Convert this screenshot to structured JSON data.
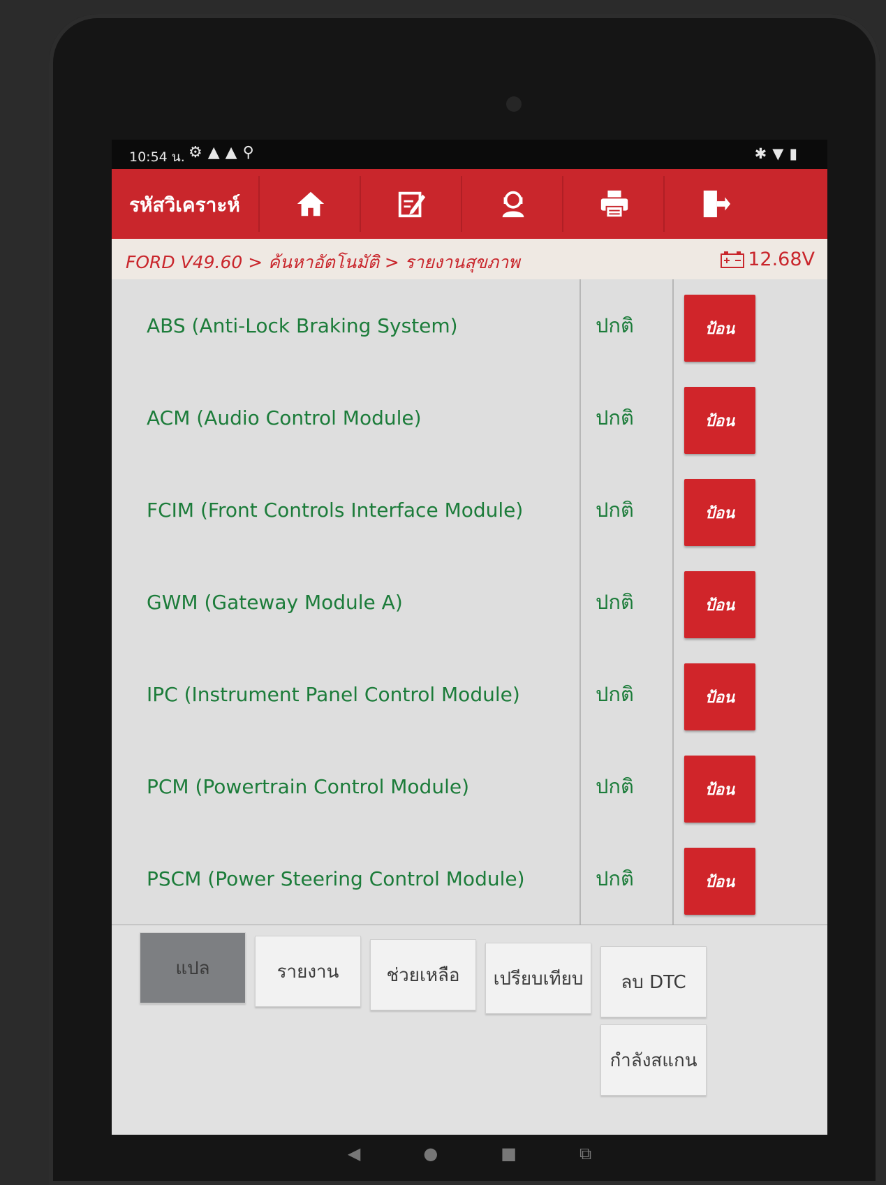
{
  "status_bar": {
    "time": "10:54 น.",
    "left_icons": [
      "settings-icon",
      "warning-icon",
      "warning-icon",
      "usb-icon"
    ],
    "right_icons": [
      "bluetooth-icon",
      "wifi-icon",
      "battery-icon"
    ]
  },
  "toolbar": {
    "title": "รหัสวิเคราะห์",
    "buttons": [
      "home-icon",
      "edit-icon",
      "support-icon",
      "print-icon",
      "exit-icon"
    ]
  },
  "breadcrumb": "FORD V49.60 > ค้นหาอัตโนมัติ > รายงานสุขภาพ",
  "voltage": "12.68V",
  "modules": [
    {
      "name": "ABS (Anti-Lock Braking System)",
      "status": "ปกติ",
      "action": "ป้อน"
    },
    {
      "name": "ACM (Audio Control Module)",
      "status": "ปกติ",
      "action": "ป้อน"
    },
    {
      "name": "FCIM (Front Controls Interface Module)",
      "status": "ปกติ",
      "action": "ป้อน"
    },
    {
      "name": "GWM (Gateway Module A)",
      "status": "ปกติ",
      "action": "ป้อน"
    },
    {
      "name": "IPC (Instrument Panel Control Module)",
      "status": "ปกติ",
      "action": "ป้อน"
    },
    {
      "name": "PCM (Powertrain Control Module)",
      "status": "ปกติ",
      "action": "ป้อน"
    },
    {
      "name": "PSCM (Power Steering Control Module)",
      "status": "ปกติ",
      "action": "ป้อน"
    }
  ],
  "bottom_buttons": {
    "translate": "แปล",
    "report": "รายงาน",
    "help": "ช่วยเหลือ",
    "compare": "เปรียบเทียบ",
    "clear_dtc": "ลบ DTC",
    "scanning": "กำลังสแกน"
  },
  "colors": {
    "accent": "#c9262c",
    "ok_text": "#1c7c3a"
  }
}
